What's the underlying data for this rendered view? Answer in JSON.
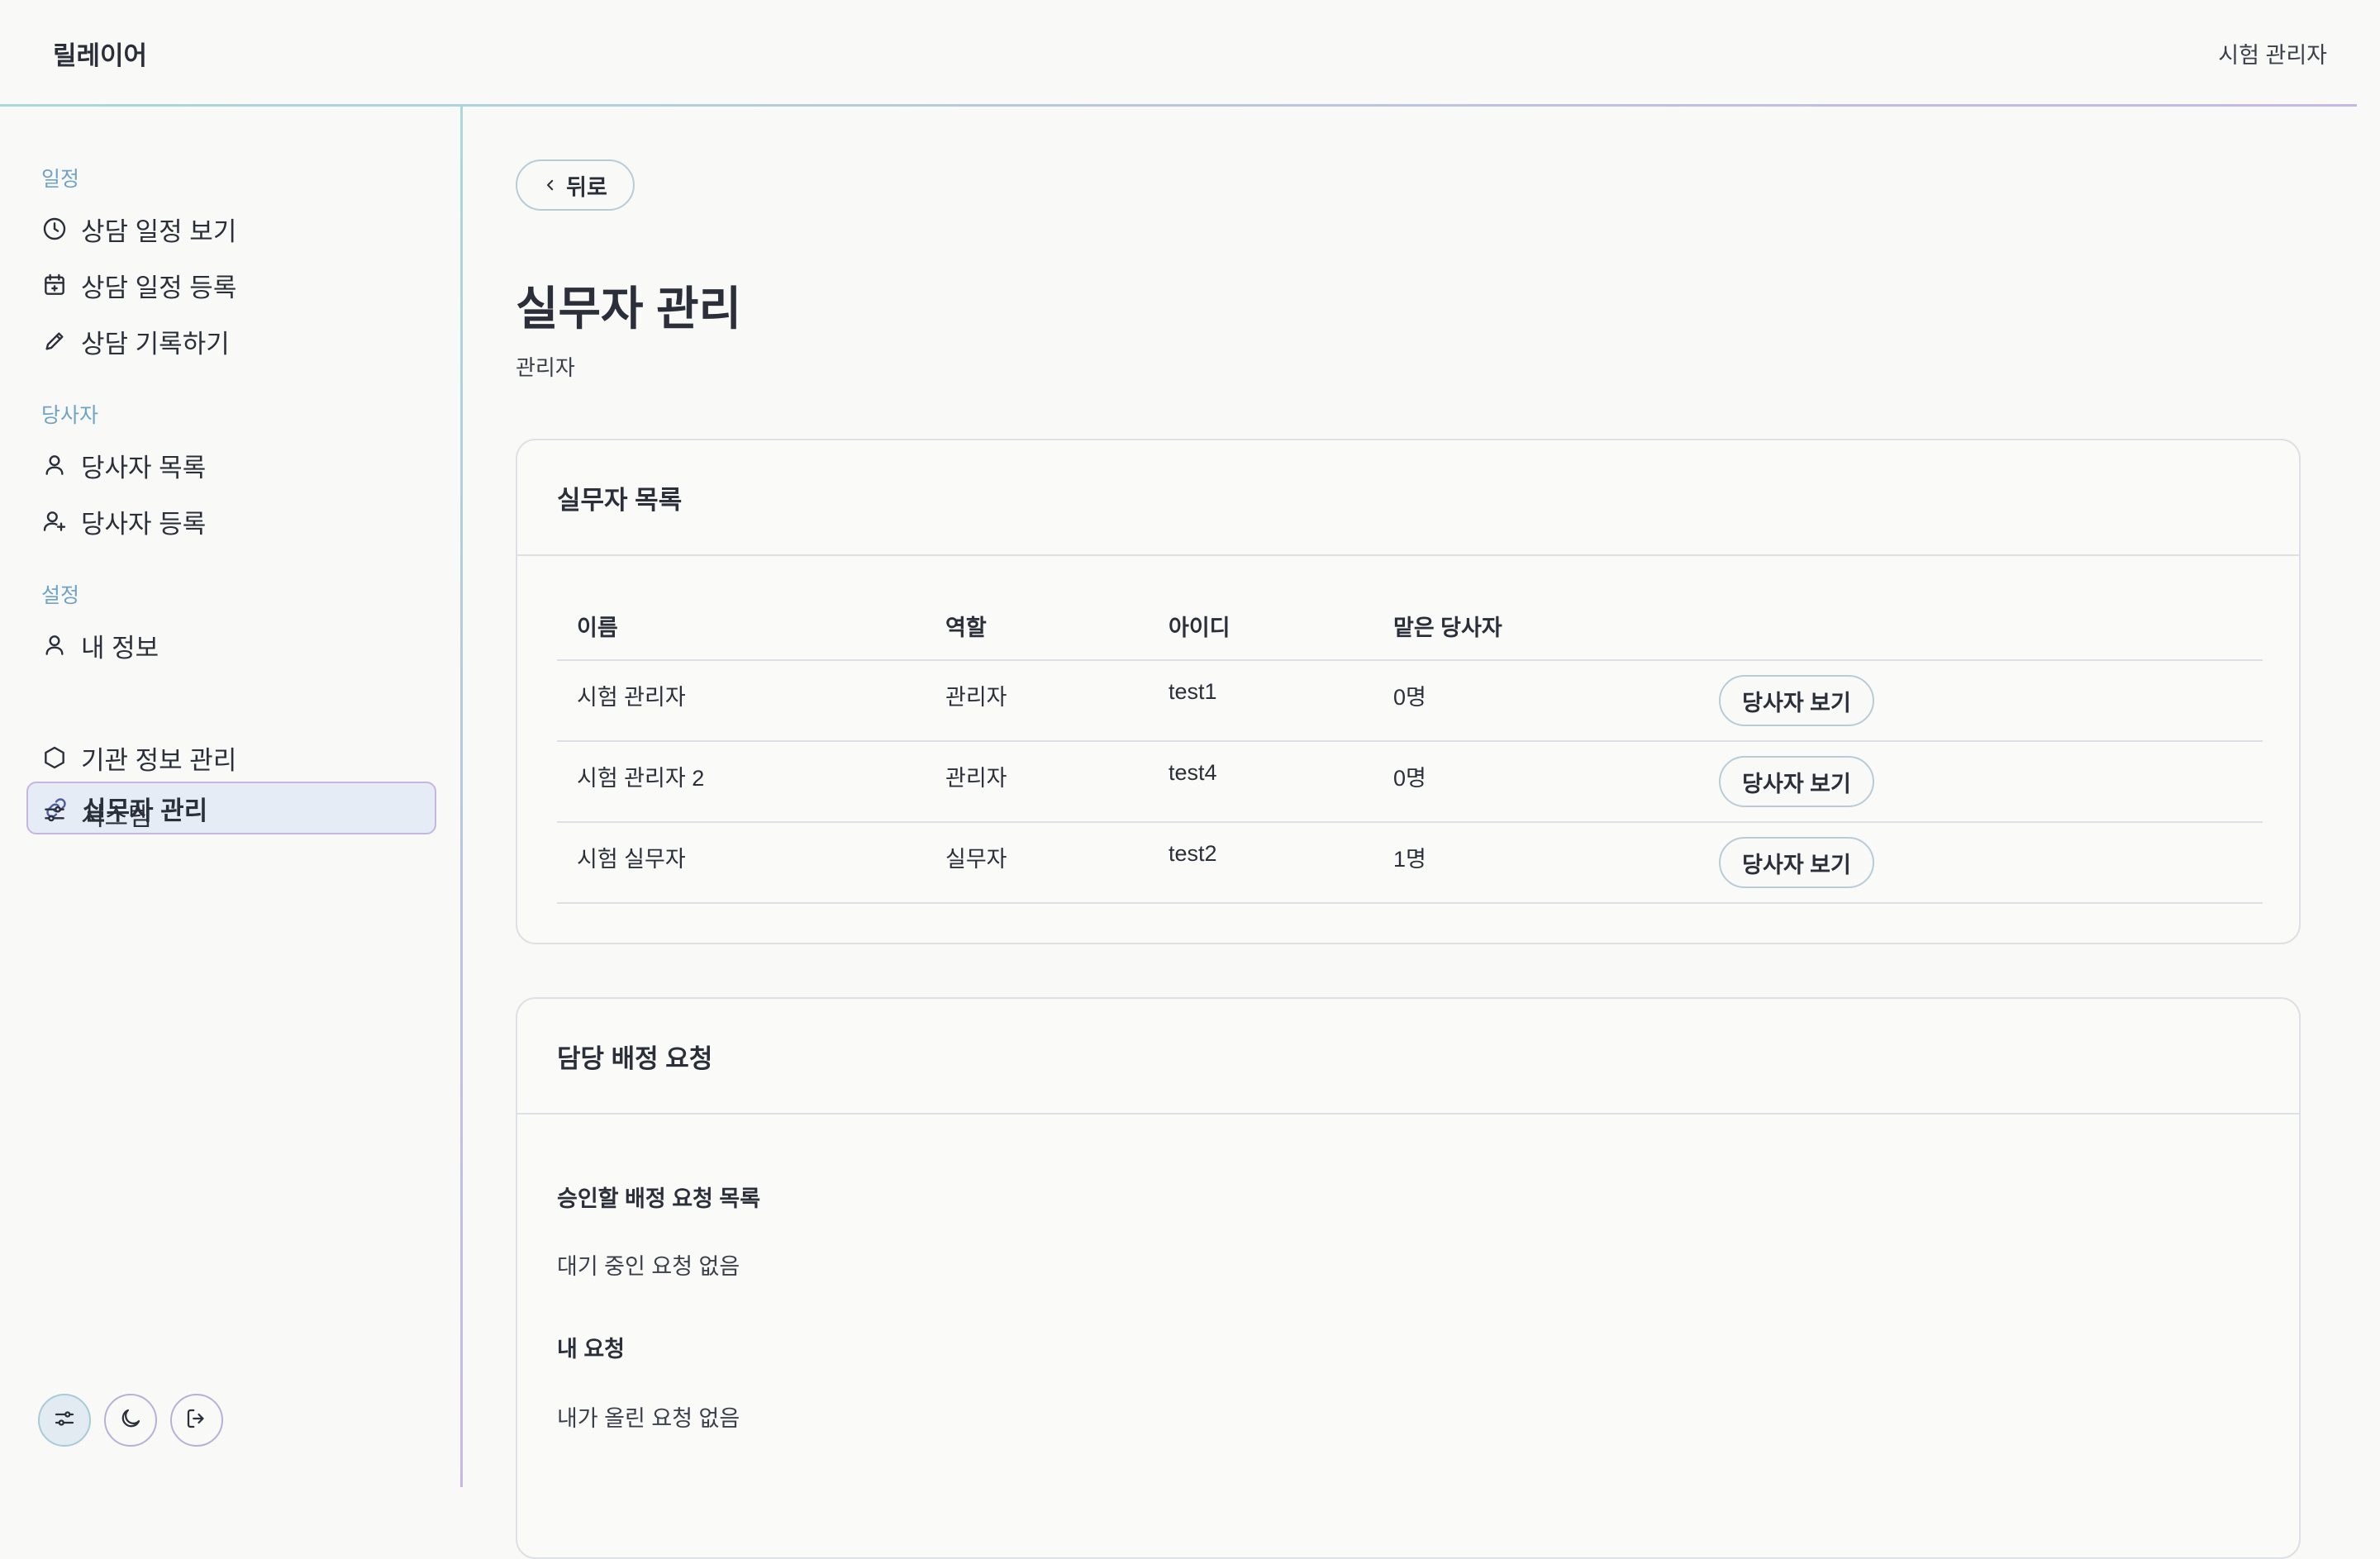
{
  "header": {
    "brand": "릴레이어",
    "user_name": "시험 관리자"
  },
  "sidebar": {
    "sections": [
      {
        "title": "일정",
        "items": [
          {
            "label": "상담 일정 보기",
            "icon": "clock-icon"
          },
          {
            "label": "상담 일정 등록",
            "icon": "calendar-add-icon"
          },
          {
            "label": "상담 기록하기",
            "icon": "pencil-icon"
          }
        ]
      },
      {
        "title": "당사자",
        "items": [
          {
            "label": "당사자 목록",
            "icon": "user-icon"
          },
          {
            "label": "당사자 등록",
            "icon": "user-plus-icon"
          }
        ]
      },
      {
        "title": "설정",
        "items": [
          {
            "label": "내 정보",
            "icon": "user-icon"
          },
          {
            "label": "실무자 관리",
            "icon": "link-icon",
            "active": true
          },
          {
            "label": "기관 정보 관리",
            "icon": "hexagon-icon"
          },
          {
            "label": "시스템",
            "icon": "sliders-icon"
          }
        ]
      }
    ],
    "footer_buttons": [
      "sliders-icon",
      "moon-icon",
      "logout-icon"
    ]
  },
  "main": {
    "back_label": "뒤로",
    "title": "실무자 관리",
    "subtitle": "관리자",
    "staff_card": {
      "title": "실무자 목록",
      "columns": [
        "이름",
        "역할",
        "아이디",
        "맡은 당사자",
        ""
      ],
      "rows": [
        {
          "name": "시험 관리자",
          "role": "관리자",
          "id": "test1",
          "clients": "0명",
          "action": "당사자 보기"
        },
        {
          "name": "시험 관리자 2",
          "role": "관리자",
          "id": "test4",
          "clients": "0명",
          "action": "당사자 보기"
        },
        {
          "name": "시험 실무자",
          "role": "실무자",
          "id": "test2",
          "clients": "1명",
          "action": "당사자 보기"
        }
      ]
    },
    "assign_card": {
      "title": "담당 배정 요청",
      "approve_heading": "승인할 배정 요청 목록",
      "approve_empty": "대기 중인 요청 없음",
      "mine_heading": "내 요청",
      "mine_empty": "내가 올린 요청 없음"
    }
  },
  "colors": {
    "accent_teal": "#a9d8d8",
    "accent_lavender": "#c7b7e8",
    "active_bg": "#e6ecf5",
    "section_title": "#6fa3c7"
  }
}
